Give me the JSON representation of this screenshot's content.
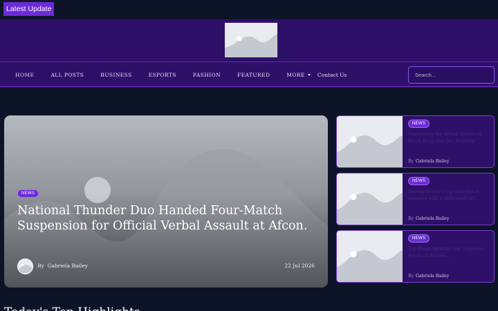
{
  "topbar": {
    "latest_label": "Latest  Update"
  },
  "nav": {
    "items": [
      "HOME",
      "ALL POSTS",
      "BUSINESS",
      "ESPORTS",
      "FASHION",
      "FEATURED"
    ],
    "more_label": "MORE",
    "contact_label": "Contact Us"
  },
  "search": {
    "placeholder": "Search..."
  },
  "hero": {
    "badge": "NEWS",
    "title": "National Thunder Duo Handed Four-Match Suspension for Official Verbal Assault at Afcon.",
    "by_label": "By",
    "author": "Gabriela Bailey",
    "date": "22 Jul 2026"
  },
  "side_posts": [
    {
      "badge": "NEWS",
      "title": "Unraveling the Actual Stories of Wyatt Earp and Doc Holliday",
      "by_label": "By",
      "author": "Gabriela Bailey"
    },
    {
      "badge": "NEWS",
      "title": "Among Avatar's top episodes is honored with a dedicated art...",
      "by_label": "By",
      "author": "Gabriela Bailey"
    },
    {
      "badge": "NEWS",
      "title": "Top Fresh Mystery and Suspense Reads: A Review...",
      "by_label": "By",
      "author": "Gabriela Bailey"
    }
  ],
  "section": {
    "title": "Today's Top Highlights"
  },
  "colors": {
    "accent": "#6b2bd6",
    "header_bg": "#2e1069",
    "page_bg": "#0e1428"
  }
}
